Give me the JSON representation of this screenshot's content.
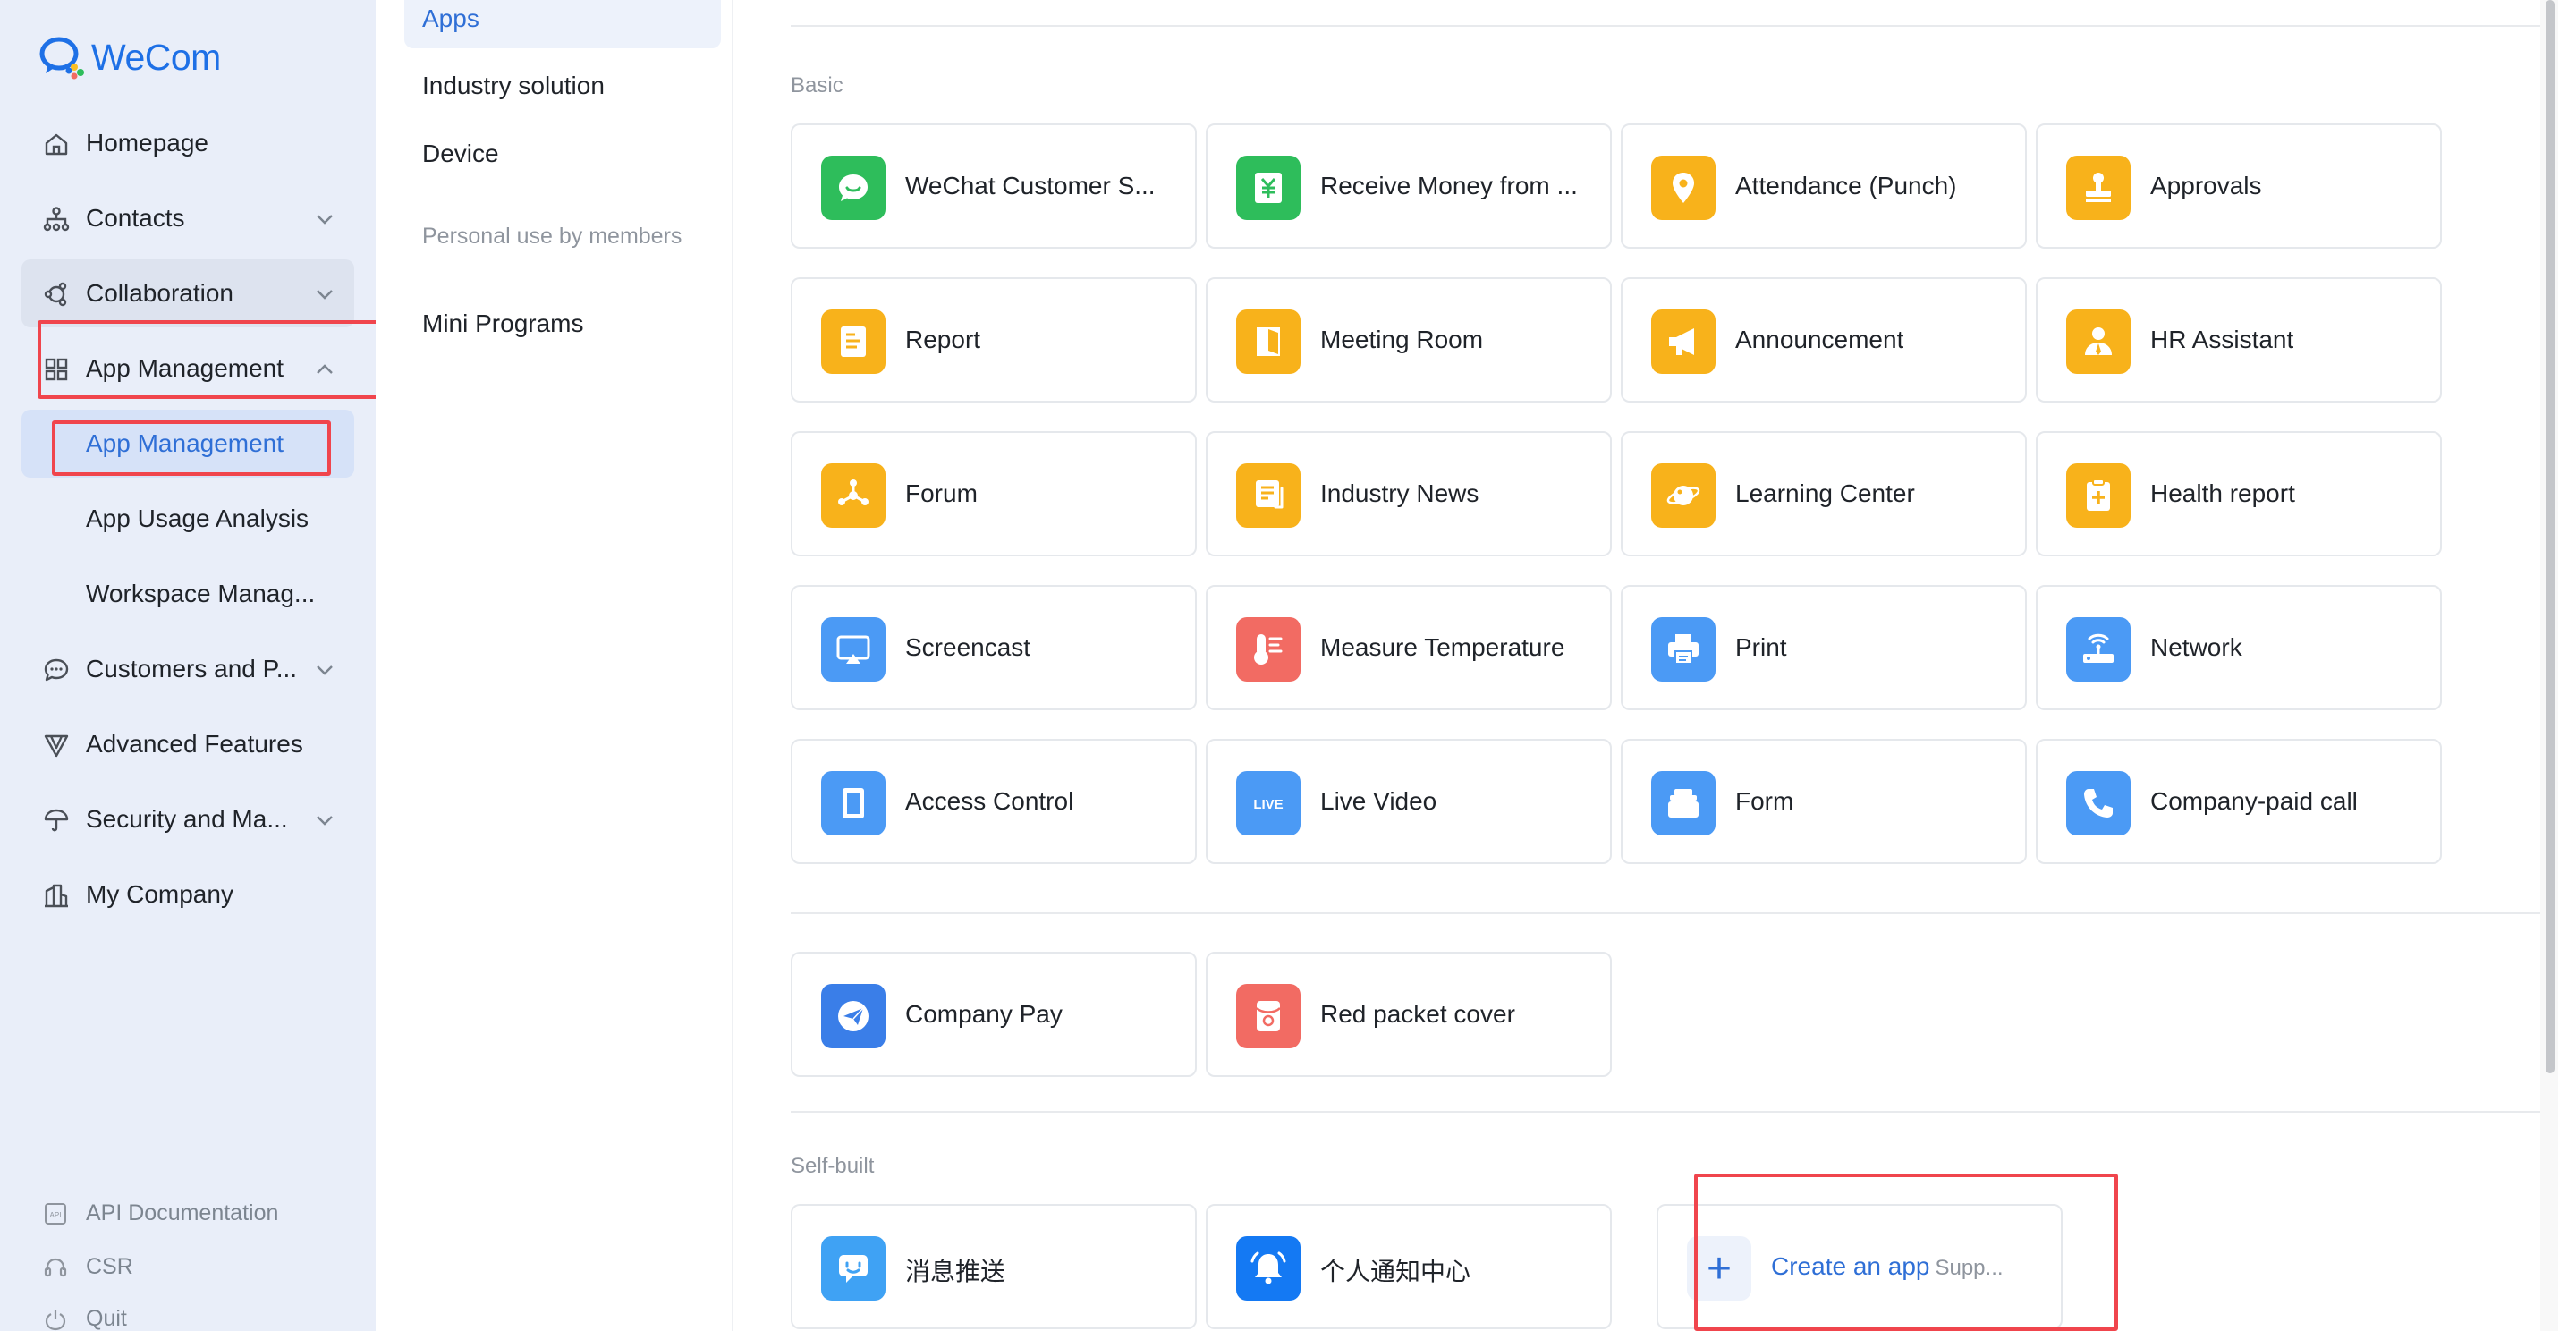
{
  "brand": {
    "name": "WeCom"
  },
  "sidebar": {
    "items": [
      {
        "label": "Homepage",
        "icon": "home-icon"
      },
      {
        "label": "Contacts",
        "icon": "org-chart-icon"
      },
      {
        "label": "Collaboration",
        "icon": "collaboration-icon"
      },
      {
        "label": "App Management",
        "icon": "grid-icon"
      },
      {
        "label": "App Management"
      },
      {
        "label": "App Usage Analysis"
      },
      {
        "label": "Workspace Manag..."
      },
      {
        "label": "Customers and P...",
        "icon": "chat-bubble-icon"
      },
      {
        "label": "Advanced Features",
        "icon": "funnel-icon"
      },
      {
        "label": "Security and Ma...",
        "icon": "umbrella-icon"
      },
      {
        "label": "My Company",
        "icon": "building-icon"
      }
    ],
    "bottom": [
      {
        "label": "API Documentation",
        "icon": "api-doc-icon"
      },
      {
        "label": "CSR",
        "icon": "headset-icon"
      },
      {
        "label": "Quit",
        "icon": "power-icon"
      }
    ]
  },
  "subnav": {
    "active": "Apps",
    "items": [
      "Industry solution",
      "Device"
    ],
    "group_label": "Personal use by members",
    "group_items": [
      "Mini Programs"
    ]
  },
  "main": {
    "basic_label": "Basic",
    "self_built_label": "Self-built",
    "basic_apps": [
      {
        "name": "WeChat Customer S...",
        "color": "#2ebd5b",
        "icon": "chat-service-icon"
      },
      {
        "name": "Receive Money from ...",
        "color": "#2ebd5b",
        "icon": "yen-icon"
      },
      {
        "name": "Attendance (Punch)",
        "color": "#f8b21b",
        "icon": "location-pin-icon"
      },
      {
        "name": "Approvals",
        "color": "#f8b21b",
        "icon": "stamp-icon"
      },
      {
        "name": "Report",
        "color": "#f8b21b",
        "icon": "report-icon"
      },
      {
        "name": "Meeting Room",
        "color": "#f8b21b",
        "icon": "door-icon"
      },
      {
        "name": "Announcement",
        "color": "#f8b21b",
        "icon": "megaphone-icon"
      },
      {
        "name": "HR Assistant",
        "color": "#f8b21b",
        "icon": "person-icon"
      },
      {
        "name": "Forum",
        "color": "#f8b21b",
        "icon": "forum-icon"
      },
      {
        "name": "Industry News",
        "color": "#f8b21b",
        "icon": "news-icon"
      },
      {
        "name": "Learning Center",
        "color": "#f8b21b",
        "icon": "planet-icon"
      },
      {
        "name": "Health report",
        "color": "#f8b21b",
        "icon": "health-clipboard-icon"
      },
      {
        "name": "Screencast",
        "color": "#4b9af5",
        "icon": "screencast-icon"
      },
      {
        "name": "Measure Temperature",
        "color": "#f26b63",
        "icon": "thermometer-icon"
      },
      {
        "name": "Print",
        "color": "#4b9af5",
        "icon": "printer-icon"
      },
      {
        "name": "Network",
        "color": "#4b9af5",
        "icon": "router-icon"
      },
      {
        "name": "Access Control",
        "color": "#4b9af5",
        "icon": "access-door-icon"
      },
      {
        "name": "Live Video",
        "color": "#4b9af5",
        "icon": "live-icon",
        "icon_text": "LIVE"
      },
      {
        "name": "Form",
        "color": "#4b9af5",
        "icon": "form-icon"
      },
      {
        "name": "Company-paid call",
        "color": "#4b9af5",
        "icon": "phone-icon"
      }
    ],
    "extra_apps": [
      {
        "name": "Company Pay",
        "color": "#3a7ee8",
        "icon": "paper-plane-icon"
      },
      {
        "name": "Red packet cover",
        "color": "#f26b63",
        "icon": "red-packet-icon"
      }
    ],
    "self_built_apps": [
      {
        "name": "消息推送",
        "color": "#3fa2f4",
        "icon": "message-push-icon"
      },
      {
        "name": "个人通知中心",
        "color": "#1479f3",
        "icon": "bell-icon"
      }
    ],
    "create": {
      "label": "Create an app",
      "sub": "Supp..."
    }
  }
}
